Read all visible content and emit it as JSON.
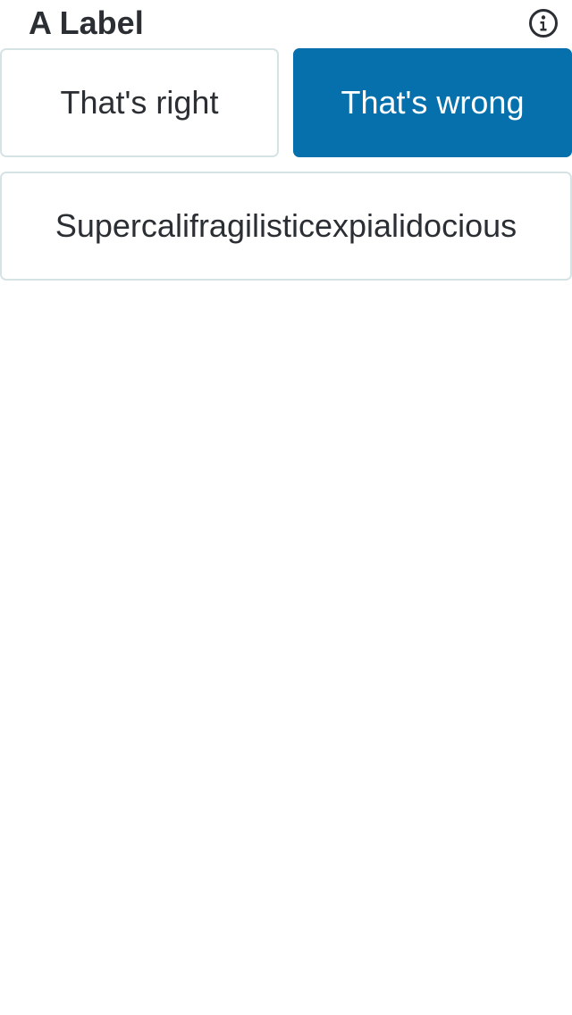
{
  "question": {
    "label": "A Label",
    "info_icon": "info-circle-icon"
  },
  "choices": [
    {
      "label": "That's right",
      "selected": false
    },
    {
      "label": "That's wrong",
      "selected": true
    },
    {
      "label": "Supercalifragilisticexpialidocious",
      "selected": false
    }
  ],
  "colors": {
    "accent": "#0670ad",
    "text": "#2b2f33",
    "border": "#d6e3e5",
    "background": "#ffffff"
  }
}
